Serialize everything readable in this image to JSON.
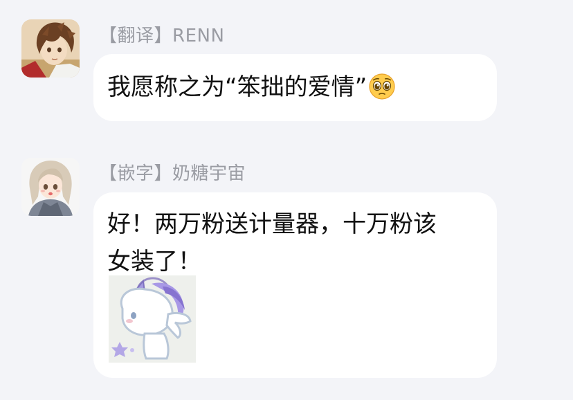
{
  "messages": [
    {
      "sender": "【翻译】RENN",
      "text": "我愿称之为“笨拙的爱情”",
      "emoji": "pleading-face-emoji",
      "avatar_icon": "anime-boy-avatar-icon"
    },
    {
      "sender": "【嵌字】奶糖宇宙",
      "text": "好！两万粉送计量器，十万粉该\n女装了！",
      "sticker": "unicorn-sticker",
      "avatar_icon": "anime-girl-avatar-icon"
    }
  ],
  "colors": {
    "background": "#f3f4f8",
    "bubble": "#ffffff",
    "sender_name": "#9a9ca3",
    "message_text": "#111111"
  }
}
